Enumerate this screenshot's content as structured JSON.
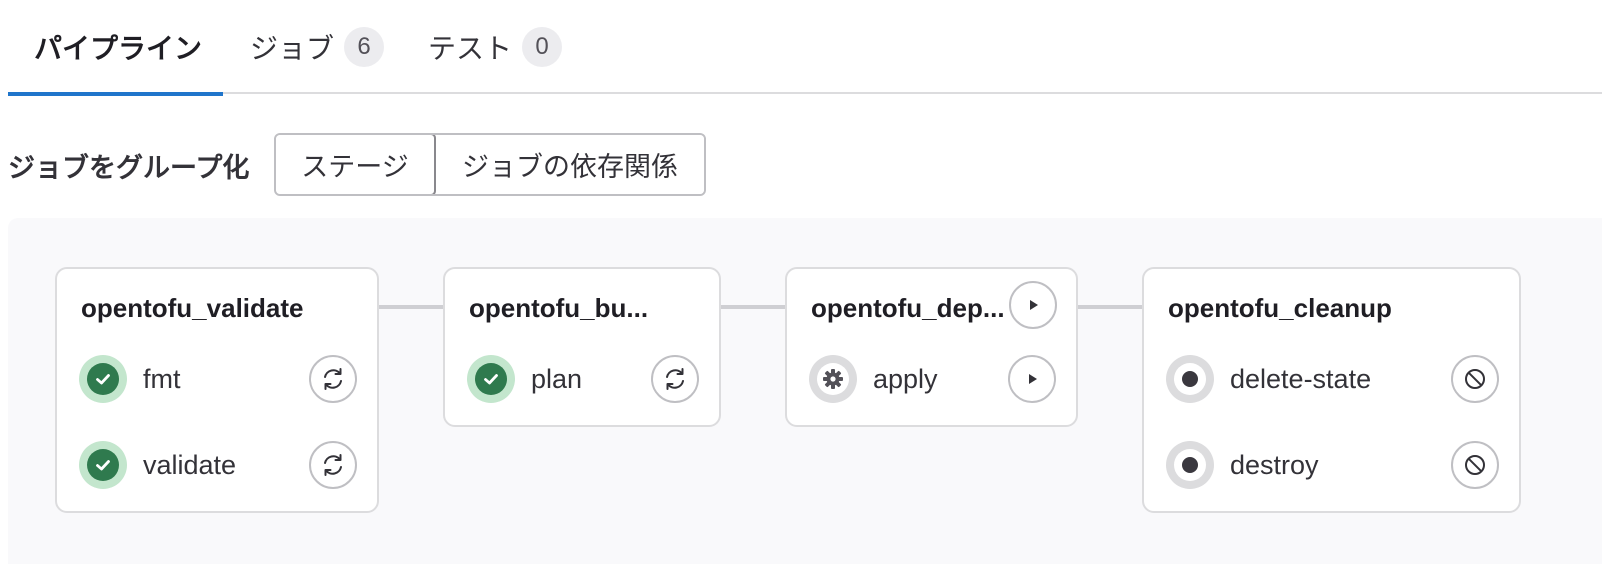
{
  "tabs": [
    {
      "label": "パイプライン",
      "active": true
    },
    {
      "label": "ジョブ",
      "count": "6"
    },
    {
      "label": "テスト",
      "count": "0"
    }
  ],
  "group_by": {
    "label": "ジョブをグループ化",
    "options": [
      "ステージ",
      "ジョブの依存関係"
    ],
    "selected": "ステージ"
  },
  "stages": [
    {
      "title": "opentofu_validate",
      "jobs": [
        {
          "name": "fmt",
          "status": "success",
          "status_icon": "check-icon",
          "action": "retry-icon"
        },
        {
          "name": "validate",
          "status": "success",
          "status_icon": "check-icon",
          "action": "retry-icon"
        }
      ]
    },
    {
      "title": "opentofu_bu...",
      "jobs": [
        {
          "name": "plan",
          "status": "success",
          "status_icon": "check-icon",
          "action": "retry-icon"
        }
      ]
    },
    {
      "title": "opentofu_dep...",
      "stage_action": "play-icon",
      "jobs": [
        {
          "name": "apply",
          "status": "manual",
          "status_icon": "gear-icon",
          "action": "play-icon"
        }
      ]
    },
    {
      "title": "opentofu_cleanup",
      "jobs": [
        {
          "name": "delete-state",
          "status": "created",
          "status_icon": "dot-icon",
          "action": "cancel-icon"
        },
        {
          "name": "destroy",
          "status": "created",
          "status_icon": "dot-icon",
          "action": "cancel-icon"
        }
      ]
    }
  ],
  "colors": {
    "tab_active_underline": "#1f75cb",
    "success_bg": "#c3e6cd",
    "success_fg": "#2f7a4e",
    "neutral_ring": "#dcdcde",
    "pipeline_bg": "#f9f9fb"
  }
}
